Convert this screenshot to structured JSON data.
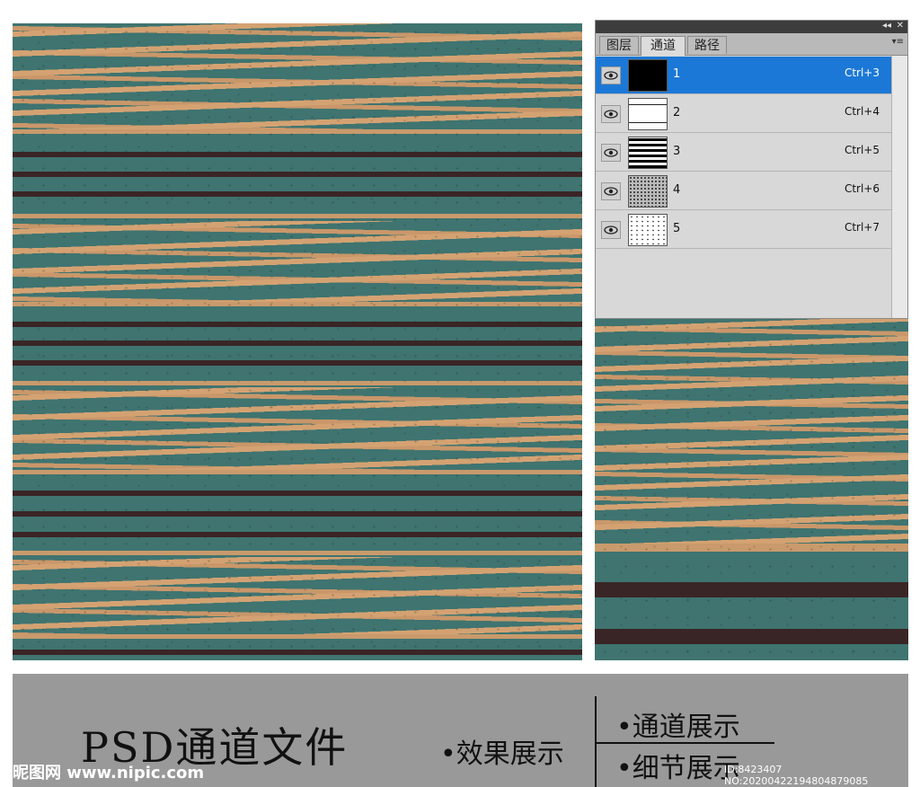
{
  "panel": {
    "collapse_icon": "◂◂",
    "close_icon": "✕",
    "menu_icon": "▾≡",
    "tabs": [
      {
        "label": "图层",
        "active": false
      },
      {
        "label": "通道",
        "active": true
      },
      {
        "label": "路径",
        "active": false
      }
    ],
    "channels": [
      {
        "name": "1",
        "shortcut": "Ctrl+3",
        "selected": true
      },
      {
        "name": "2",
        "shortcut": "Ctrl+4",
        "selected": false
      },
      {
        "name": "3",
        "shortcut": "Ctrl+5",
        "selected": false
      },
      {
        "name": "4",
        "shortcut": "Ctrl+6",
        "selected": false
      },
      {
        "name": "5",
        "shortcut": "Ctrl+7",
        "selected": false
      }
    ],
    "selected_color": "#1c78d6"
  },
  "caption": {
    "title": "PSD通道文件",
    "effect": "•效果展示",
    "channels": "•通道展示",
    "detail": "•细节展示"
  },
  "watermark": {
    "site": "昵图网 www.nipic.com",
    "id": "ID:8423407 NO:20200422194804879085"
  },
  "colors": {
    "teal": "#3f7470",
    "tan": "#d4a272",
    "dark_brown": "#3a2526",
    "caption_bg": "#999999"
  }
}
